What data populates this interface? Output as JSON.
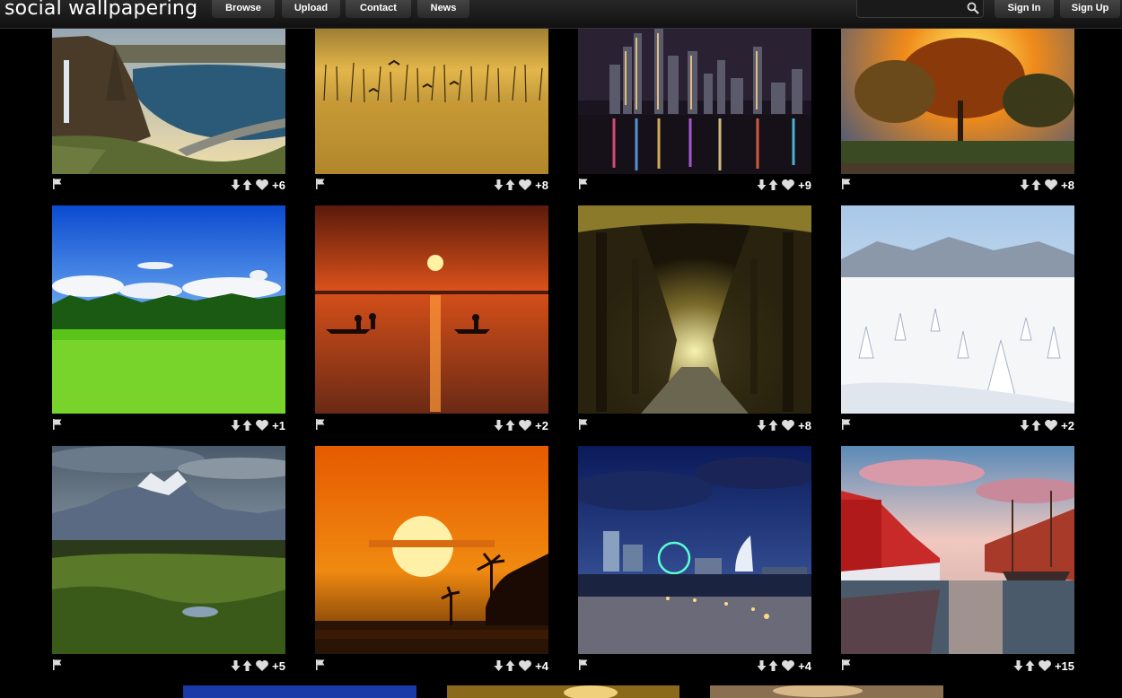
{
  "header": {
    "logo": "social wallpapering",
    "nav": [
      {
        "id": "browse",
        "label": "Browse"
      },
      {
        "id": "upload",
        "label": "Upload"
      },
      {
        "id": "contact",
        "label": "Contact"
      },
      {
        "id": "news",
        "label": "News"
      }
    ],
    "search": {
      "placeholder": "",
      "icon": "search-icon"
    },
    "sign_in": "Sign In",
    "sign_up": "Sign Up"
  },
  "wallpapers": [
    {
      "scene": "waterfall-lake-canyon",
      "score": "+6"
    },
    {
      "scene": "golden-marsh-birds",
      "score": "+8"
    },
    {
      "scene": "city-skyline-night",
      "score": "+9"
    },
    {
      "scene": "autumn-tree-sunset",
      "score": "+8"
    },
    {
      "scene": "green-meadow-blue-sky",
      "score": "+1"
    },
    {
      "scene": "kayaks-red-sunset",
      "score": "+2"
    },
    {
      "scene": "tree-tunnel-path",
      "score": "+8"
    },
    {
      "scene": "snowy-mountain-forest",
      "score": "+2"
    },
    {
      "scene": "mountain-valley-hills",
      "score": "+5"
    },
    {
      "scene": "orange-sun-palms",
      "score": "+4"
    },
    {
      "scene": "harbor-city-dusk",
      "score": "+4"
    },
    {
      "scene": "canal-boats-reflection",
      "score": "+15"
    }
  ],
  "icons": {
    "flag": "flag-icon",
    "down": "arrow-down-icon",
    "up": "arrow-up-icon",
    "like": "heart-icon"
  }
}
